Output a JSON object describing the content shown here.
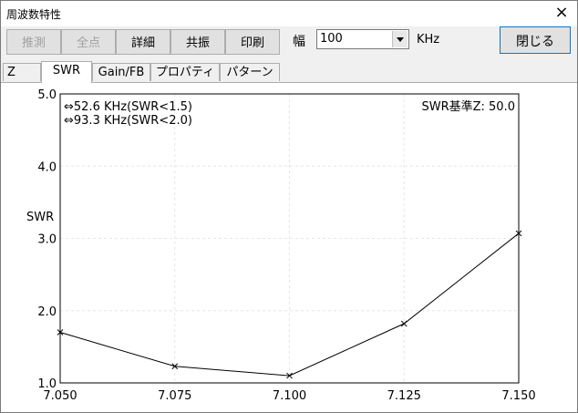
{
  "window": {
    "title": "周波数特性",
    "close_symbol": "×"
  },
  "toolbar": {
    "estimate_label": "推測",
    "all_points_label": "全点",
    "details_label": "詳細",
    "resonance_label": "共振",
    "print_label": "印刷",
    "width_label": "幅",
    "width_value": "100",
    "width_unit": "KHz",
    "close_label": "閉じる"
  },
  "tabs": [
    {
      "label": "Z"
    },
    {
      "label": "SWR"
    },
    {
      "label": "Gain/FB"
    },
    {
      "label": "プロパティ"
    },
    {
      "label": "パターン"
    }
  ],
  "annotations": {
    "bw15": "⇔52.6 KHz(SWR<1.5)",
    "bw20": "⇔93.3 KHz(SWR<2.0)",
    "reference": "SWR基準Z: 50.0"
  },
  "chart_data": {
    "type": "line",
    "ylabel": "SWR",
    "xlabel": "",
    "x": [
      7.05,
      7.075,
      7.1,
      7.125,
      7.15
    ],
    "series": [
      {
        "values": [
          1.7,
          1.23,
          1.1,
          1.82,
          3.07
        ]
      }
    ],
    "xlim": [
      7.05,
      7.15
    ],
    "ylim": [
      1.0,
      5.0
    ],
    "x_ticks": [
      "7.050",
      "7.075",
      "7.100",
      "7.125",
      "7.150"
    ],
    "y_ticks": [
      "1.0",
      "2.0",
      "3.0",
      "4.0",
      "5.0"
    ],
    "grid": true
  },
  "colors": {
    "grid": "#e6e6e6",
    "line": "#000000",
    "plot_bg": "#ffffff"
  }
}
